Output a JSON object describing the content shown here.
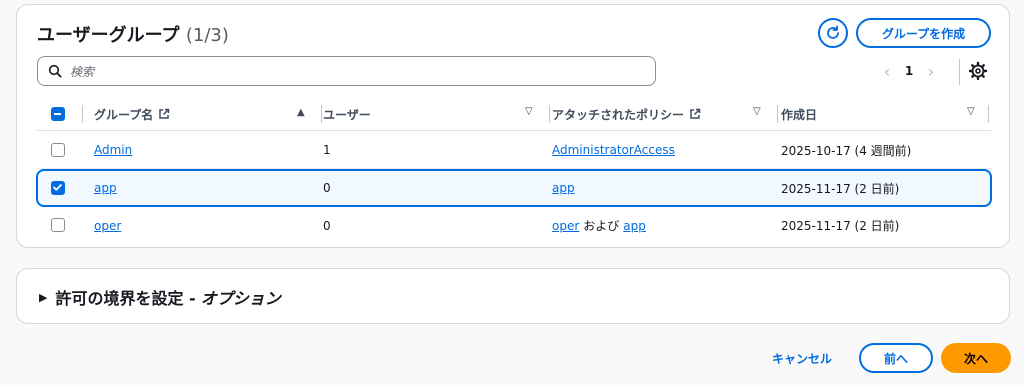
{
  "groups": {
    "title": "ユーザーグループ",
    "count": "(1/3)",
    "create_label": "グループを作成",
    "search_placeholder": "検索",
    "page": "1",
    "columns": [
      "グループ名",
      "ユーザー",
      "アタッチされたポリシー",
      "作成日"
    ],
    "rows": [
      {
        "name": "Admin",
        "users": "1",
        "policy_main": "AdministratorAccess",
        "policy_and": "",
        "policy_extra": "",
        "created": "2025-10-17 (4 週間前)",
        "selected": false
      },
      {
        "name": "app",
        "users": "0",
        "policy_main": "app",
        "policy_and": "",
        "policy_extra": "",
        "created": "2025-11-17 (2 日前)",
        "selected": true
      },
      {
        "name": "oper",
        "users": "0",
        "policy_main": "oper",
        "policy_and": "および",
        "policy_extra": "app",
        "created": "2025-11-17 (2 日前)",
        "selected": false
      }
    ]
  },
  "boundary": {
    "label": "許可の境界を設定 -",
    "option": "オプション"
  },
  "footer": {
    "cancel": "キャンセル",
    "prev": "前へ",
    "next": "次へ"
  },
  "colors": {
    "accent": "#006ce0",
    "primary_button": "#ff9900",
    "selected_row_bg": "#f1f8ff"
  }
}
